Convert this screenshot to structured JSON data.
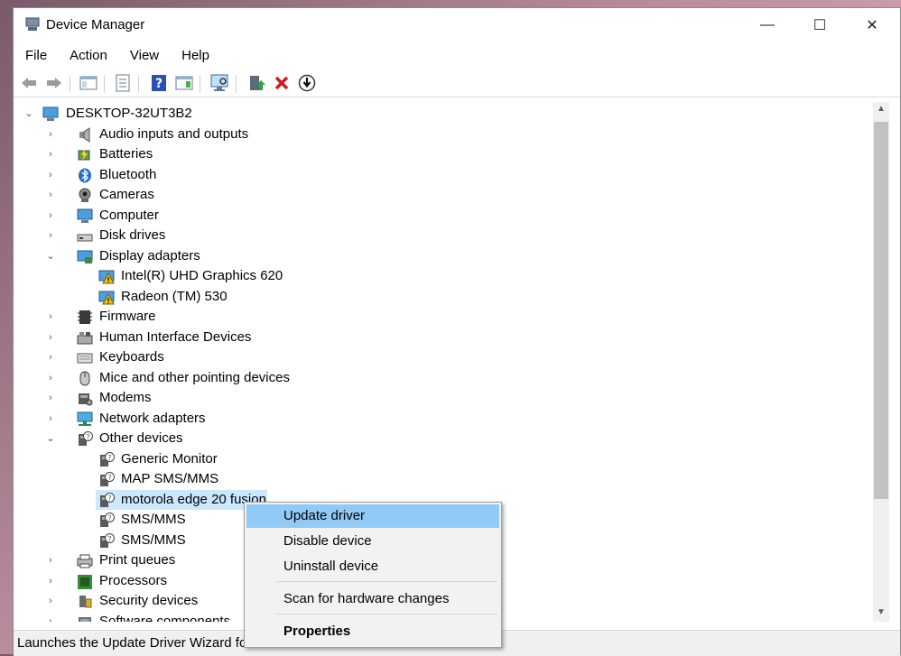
{
  "window": {
    "title": "Device Manager",
    "min": "—",
    "max": "☐",
    "close": "✕"
  },
  "menu": [
    "File",
    "Action",
    "View",
    "Help"
  ],
  "toolbar": [
    "back-icon",
    "forward-icon",
    "show-hide-tree-icon",
    "properties-icon",
    "help-icon",
    "action-pane-icon",
    "scan-hardware-icon",
    "update-driver-icon",
    "uninstall-icon",
    "disable-device-icon"
  ],
  "tree": {
    "root": "DESKTOP-32UT3B2",
    "items": [
      {
        "label": "Audio inputs and outputs",
        "icon": "speaker-icon"
      },
      {
        "label": "Batteries",
        "icon": "battery-icon"
      },
      {
        "label": "Bluetooth",
        "icon": "bluetooth-icon"
      },
      {
        "label": "Cameras",
        "icon": "camera-icon"
      },
      {
        "label": "Computer",
        "icon": "computer-icon"
      },
      {
        "label": "Disk drives",
        "icon": "disk-drive-icon"
      },
      {
        "label": "Display adapters",
        "icon": "display-adapter-icon",
        "expanded": true
      },
      {
        "label": "Intel(R) UHD Graphics 620",
        "icon": "warning-display-icon",
        "child": true
      },
      {
        "label": "Radeon (TM) 530",
        "icon": "warning-display-icon",
        "child": true
      },
      {
        "label": "Firmware",
        "icon": "firmware-icon"
      },
      {
        "label": "Human Interface Devices",
        "icon": "hid-icon"
      },
      {
        "label": "Keyboards",
        "icon": "keyboard-icon"
      },
      {
        "label": "Mice and other pointing devices",
        "icon": "mouse-icon"
      },
      {
        "label": "Modems",
        "icon": "modem-icon"
      },
      {
        "label": "Network adapters",
        "icon": "network-icon"
      },
      {
        "label": "Other devices",
        "icon": "unknown-device-icon",
        "expanded": true
      },
      {
        "label": "Generic Monitor",
        "icon": "unknown-device-icon",
        "child": true
      },
      {
        "label": "MAP SMS/MMS",
        "icon": "unknown-device-icon",
        "child": true
      },
      {
        "label": "motorola edge 20 fusion",
        "icon": "unknown-device-icon",
        "child": true,
        "selected": true
      },
      {
        "label": "SMS/MMS",
        "icon": "unknown-device-icon",
        "child": true
      },
      {
        "label": "SMS/MMS",
        "icon": "unknown-device-icon",
        "child": true
      },
      {
        "label": "Print queues",
        "icon": "printer-icon"
      },
      {
        "label": "Processors",
        "icon": "processor-icon"
      },
      {
        "label": "Security devices",
        "icon": "security-icon"
      },
      {
        "label": "Software components",
        "icon": "software-icon"
      }
    ]
  },
  "context_menu": {
    "update": "Update driver",
    "disable": "Disable device",
    "uninstall": "Uninstall device",
    "scan": "Scan for hardware changes",
    "properties": "Properties"
  },
  "status": "Launches the Update Driver Wizard for"
}
